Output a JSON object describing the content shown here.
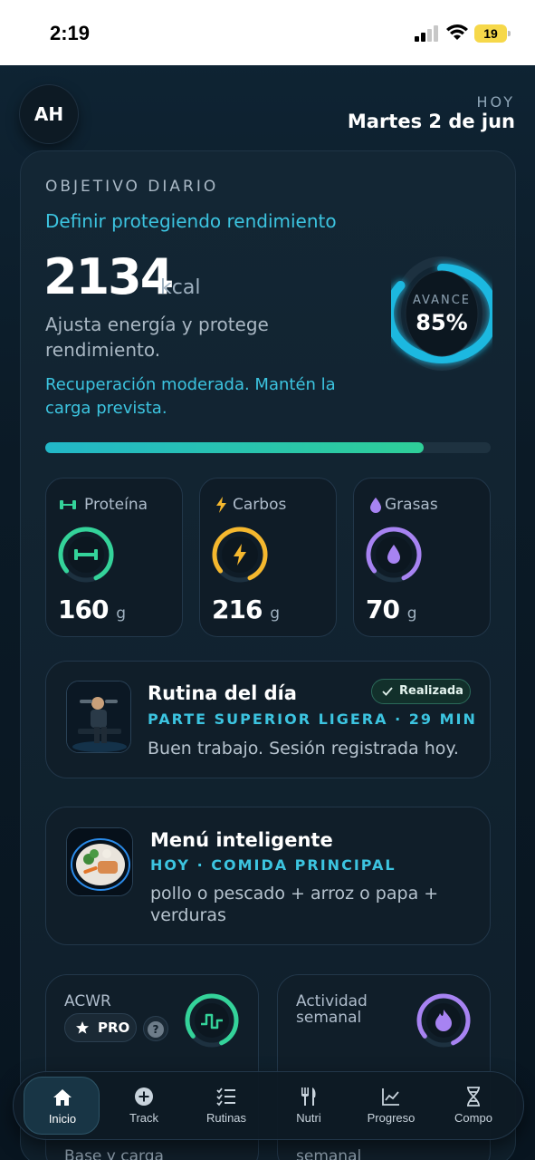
{
  "status_bar": {
    "time": "2:19",
    "battery": "19"
  },
  "header": {
    "avatar_initials": "AH",
    "today_label": "HOY",
    "date": "Martes 2 de jun"
  },
  "objective": {
    "title": "OBJETIVO DIARIO",
    "subtitle": "Definir protegiendo rendimiento",
    "kcal_value": "2134",
    "kcal_unit": "kcal",
    "description": "Ajusta energía y protege rendimiento.",
    "note": "Recuperación moderada. Mantén la carga prevista.",
    "progress_label": "AVANCE",
    "progress_text": "85%",
    "progress_fraction": 0.85,
    "accent_color": "#3cc4e0"
  },
  "macros": [
    {
      "label": "Proteína",
      "value": "160",
      "unit": "g",
      "color": "#34d39a",
      "icon": "dumbbell-icon"
    },
    {
      "label": "Carbos",
      "value": "216",
      "unit": "g",
      "color": "#f5b82e",
      "icon": "bolt-icon"
    },
    {
      "label": "Grasas",
      "value": "70",
      "unit": "g",
      "color": "#a783f2",
      "icon": "drop-icon"
    }
  ],
  "routine": {
    "title": "Rutina del día",
    "badge": "Realizada",
    "tag": "PARTE SUPERIOR LIGERA · 29 MIN",
    "body": "Buen trabajo. Sesión registrada hoy."
  },
  "menu": {
    "title": "Menú inteligente",
    "tag": "HOY · COMIDA PRINCIPAL",
    "body": "pollo o pescado + arroz o papa + verduras"
  },
  "acwr": {
    "title": "ACWR",
    "pro_label": "PRO",
    "help": "?",
    "below": "Base y carga"
  },
  "activity": {
    "title": "Actividad semanal",
    "below": "semanal"
  },
  "nav": [
    {
      "label": "Inicio",
      "icon": "home-icon"
    },
    {
      "label": "Track",
      "icon": "plus-circle-icon"
    },
    {
      "label": "Rutinas",
      "icon": "checklist-icon"
    },
    {
      "label": "Nutri",
      "icon": "cutlery-icon"
    },
    {
      "label": "Progreso",
      "icon": "chart-line-icon"
    },
    {
      "label": "Compo",
      "icon": "dna-icon"
    }
  ]
}
